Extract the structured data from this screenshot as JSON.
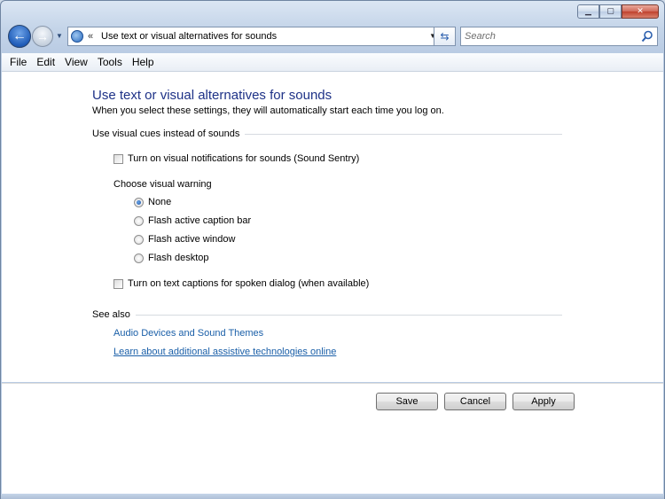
{
  "window": {
    "caption_buttons": {
      "minimize": "▁",
      "maximize": "▢",
      "close": "✕"
    }
  },
  "nav": {
    "back_icon": "back-arrow",
    "forward_icon": "forward-arrow",
    "address_chevron": "«",
    "address_text": "Use text or visual alternatives for sounds",
    "search_placeholder": "Search"
  },
  "menu": {
    "items": [
      {
        "label": "File"
      },
      {
        "label": "Edit"
      },
      {
        "label": "View"
      },
      {
        "label": "Tools"
      },
      {
        "label": "Help"
      }
    ]
  },
  "page": {
    "title": "Use text or visual alternatives for sounds",
    "description": "When you select these settings, they will automatically start each time you log on.",
    "visual_cues_heading": "Use visual cues instead of sounds",
    "sound_sentry_label": "Turn on visual notifications for sounds (Sound Sentry)",
    "sound_sentry_checked": false,
    "visual_warning_label": "Choose visual warning",
    "radio_options": [
      {
        "label": "None",
        "checked": true
      },
      {
        "label": "Flash active caption bar",
        "checked": false
      },
      {
        "label": "Flash active window",
        "checked": false
      },
      {
        "label": "Flash desktop",
        "checked": false
      }
    ],
    "text_captions_label": "Turn on text captions for spoken dialog (when available)",
    "text_captions_checked": false,
    "see_also_heading": "See also",
    "links": [
      {
        "label": "Audio Devices and Sound Themes"
      },
      {
        "label": "Learn about additional assistive technologies online"
      }
    ]
  },
  "footer": {
    "save_label": "Save",
    "cancel_label": "Cancel",
    "apply_label": "Apply"
  },
  "colors": {
    "title": "#1e3287",
    "link": "#1a5fa8",
    "chrome": "#c5d5e9"
  }
}
